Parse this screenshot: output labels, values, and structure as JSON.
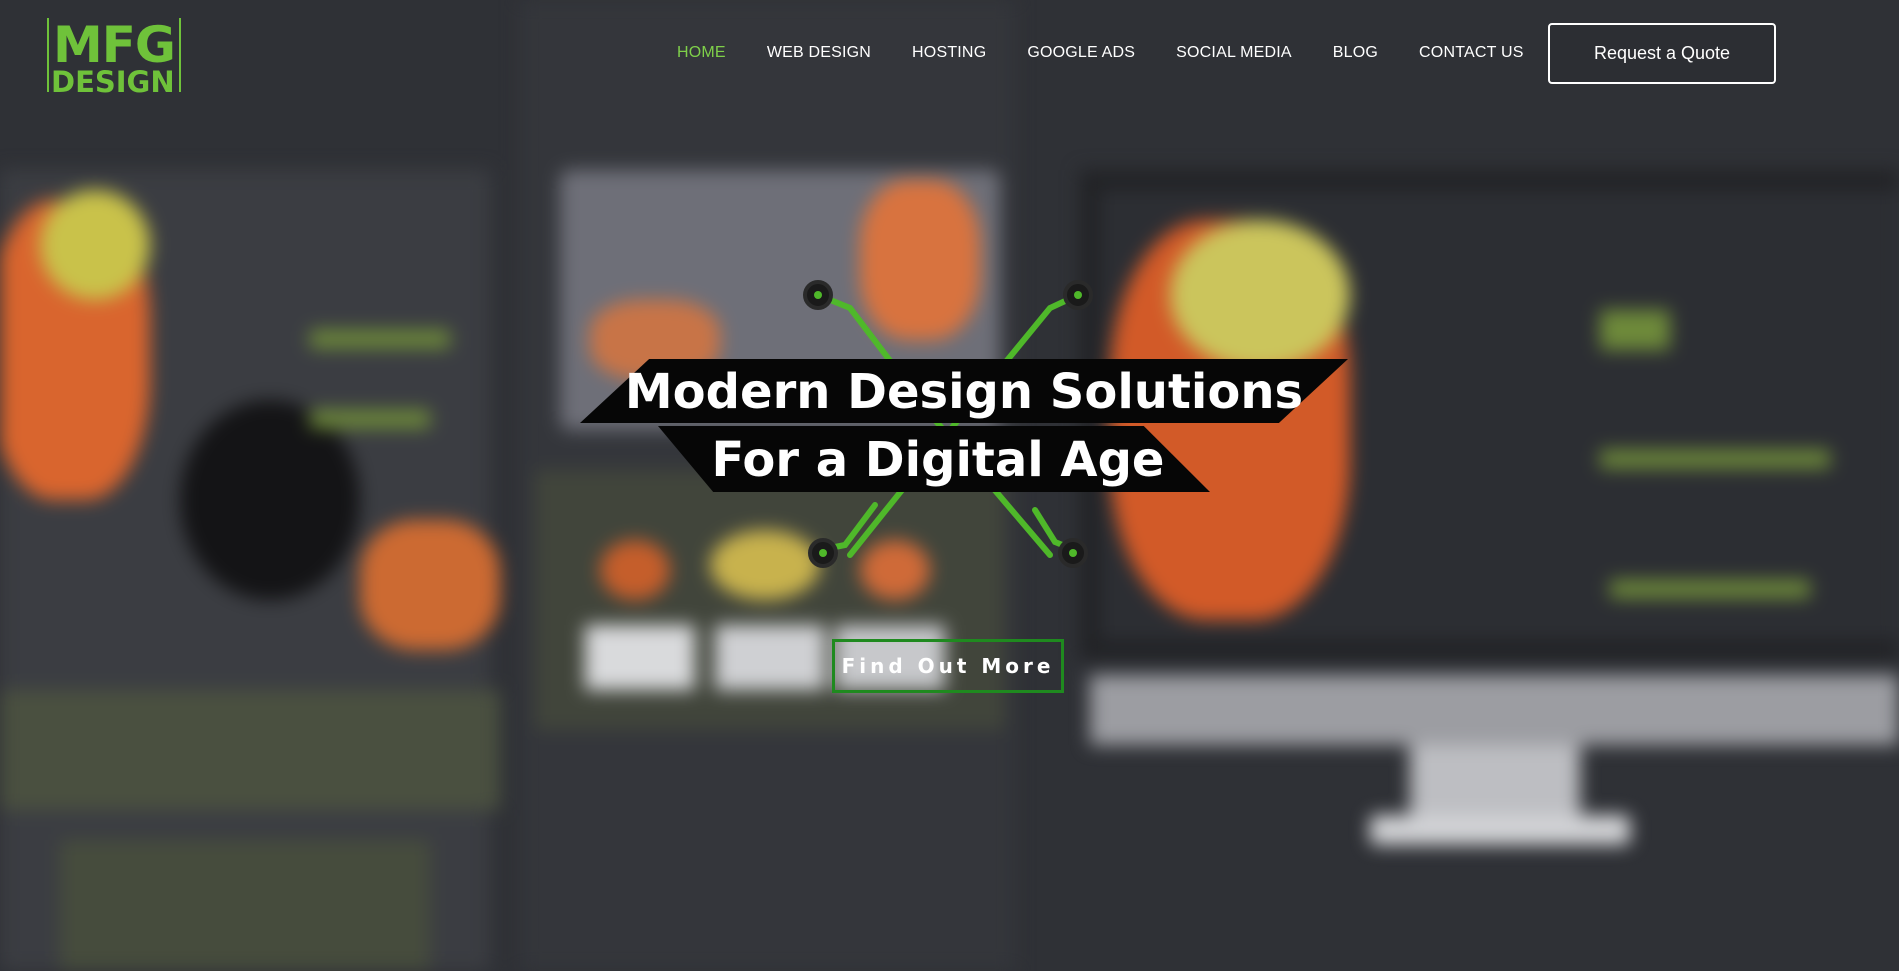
{
  "logo": {
    "line1": "MFG",
    "line2": "DESIGN"
  },
  "nav": {
    "items": [
      {
        "label": "HOME",
        "active": true
      },
      {
        "label": "WEB DESIGN",
        "active": false
      },
      {
        "label": "HOSTING",
        "active": false
      },
      {
        "label": "GOOGLE ADS",
        "active": false
      },
      {
        "label": "SOCIAL MEDIA",
        "active": false
      },
      {
        "label": "BLOG",
        "active": false
      },
      {
        "label": "CONTACT US",
        "active": false
      }
    ],
    "cta_label": "Request a Quote"
  },
  "hero": {
    "headline_line1": "Modern Design Solutions",
    "headline_line2": "For a Digital Age",
    "button_label": "Find Out More"
  },
  "colors": {
    "accent": "#7fd04a",
    "logo": "#6fc23a",
    "button_border": "#1f8a1f",
    "background": "#2f3136"
  }
}
